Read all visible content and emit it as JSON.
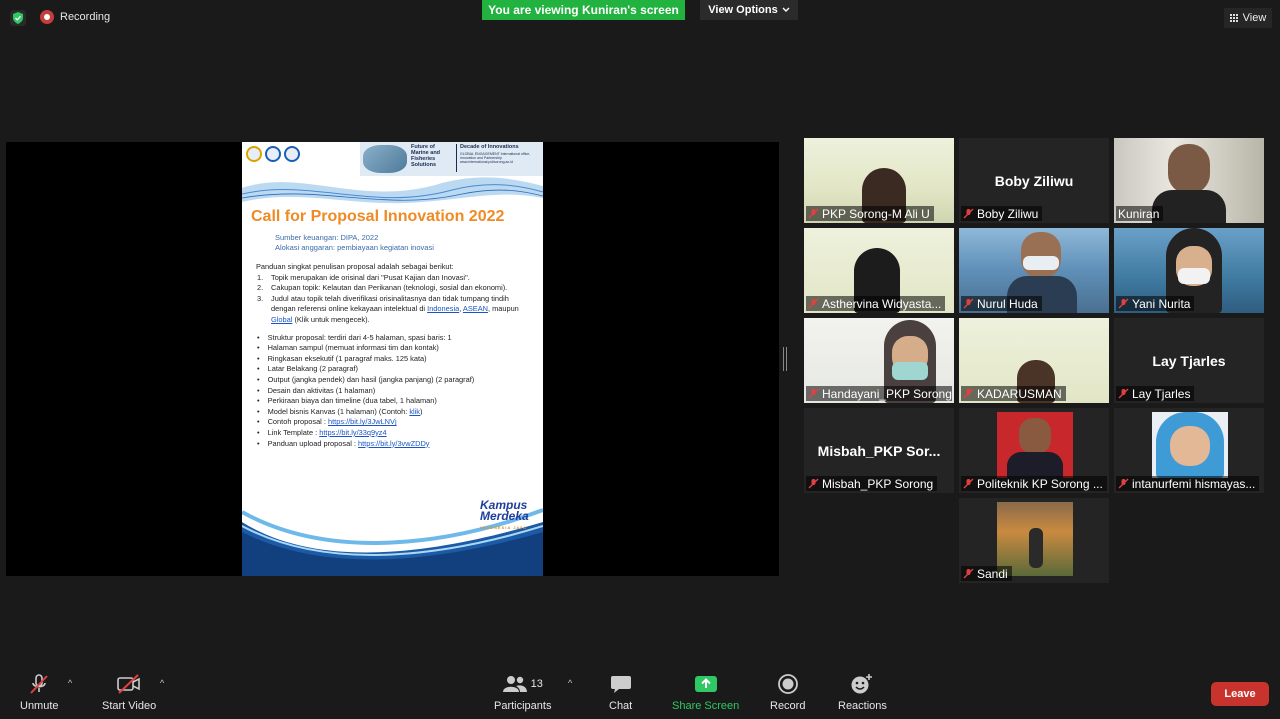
{
  "top_bar": {
    "recording_label": "Recording",
    "viewing_banner": "You are viewing Kuniran's screen",
    "view_options_label": "View Options",
    "view_label": "View"
  },
  "shared_screen": {
    "banner_left": "Future of Marine and Fisheries Solutions",
    "banner_right": "Decade of Innovations",
    "banner_right_sub": "GLOBAL ENGAGEMENT International office, Innovation and Partnership www.international.polisorong.ac.id",
    "title": "Call for Proposal Innovation 2022",
    "sub1": "Sumber keuangan: DIPA, 2022",
    "sub2": "Alokasi anggaran: pembiayaan kegiatan inovasi",
    "intro": "Panduan singkat penulisan proposal adalah sebagai berikut:",
    "numbered": [
      {
        "n": "1.",
        "text": "Topik merupakan ide orisinal dari \"Pusat Kajian dan Inovasi\"."
      },
      {
        "n": "2.",
        "text": "Cakupan topik: Kelautan dan Perikanan (teknologi, sosial dan ekonomi)."
      },
      {
        "n": "3.",
        "text": "Judul atau topik telah diverifikasi orisinalitasnya dan tidak tumpang tindih dengan referensi online kekayaan intelektual di"
      }
    ],
    "link_indonesia": "Indonesia",
    "link_asean": "ASEAN",
    "link_global": "Global",
    "item3_tail": "(Klik untuk mengecek).",
    "bullets": [
      "Struktur proposal: terdiri dari 4-5 halaman, spasi baris: 1",
      "Halaman sampul (memuat informasi tim dan kontak)",
      "Ringkasan eksekutif (1 paragraf maks. 125 kata)",
      "Latar Belakang (2 paragraf)",
      "Output (jangka pendek) dan hasil (jangka panjang) (2 paragraf)",
      "Desain dan aktivitas (1 halaman)",
      "Perkiraan biaya dan timeline (dua tabel, 1 halaman)"
    ],
    "bullet_kanvas": "Model bisnis Kanvas (1 halaman) (Contoh:",
    "bullet_kanvas_link": "klik",
    "bullet_contoh": "Contoh proposal :",
    "bullet_contoh_link": "https://bit.ly/3JwLNVj",
    "bullet_template": "Link Template :",
    "bullet_template_link": "https://bit.ly/33q9yz4",
    "bullet_upload": "Panduan upload proposal :",
    "bullet_upload_link": "https://bit.ly/3vwZDDy",
    "brand_line1": "Kampus",
    "brand_line2": "Merdeka",
    "brand_small": "INDONESIA JAYA"
  },
  "participants": [
    {
      "label": "PKP Sorong-M Ali U",
      "big": ""
    },
    {
      "label": "Boby Ziliwu",
      "big": "Boby Ziliwu"
    },
    {
      "label": "Kuniran",
      "big": ""
    },
    {
      "label": "Asthervina Widyasta...",
      "big": ""
    },
    {
      "label": "Nurul Huda",
      "big": ""
    },
    {
      "label": "Yani Nurita",
      "big": ""
    },
    {
      "label": "Handayani_PKP Sorong",
      "big": ""
    },
    {
      "label": "KADARUSMAN",
      "big": ""
    },
    {
      "label": "Lay Tjarles",
      "big": "Lay Tjarles"
    },
    {
      "label": "Misbah_PKP Sorong",
      "big": "Misbah_PKP  Sor..."
    },
    {
      "label": "Politeknik KP Sorong ...",
      "big": ""
    },
    {
      "label": "intanurfemi hismayas...",
      "big": ""
    },
    {
      "label": "Sandi",
      "big": ""
    }
  ],
  "toolbar": {
    "unmute": "Unmute",
    "start_video": "Start Video",
    "participants": "Participants",
    "participants_count": "13",
    "chat": "Chat",
    "share_screen": "Share Screen",
    "record": "Record",
    "reactions": "Reactions",
    "leave": "Leave"
  },
  "colors": {
    "accent_green": "#21b23f",
    "active_speaker": "#b8d94a",
    "leave_red": "#c8332d",
    "poster_title": "#f08a24"
  }
}
